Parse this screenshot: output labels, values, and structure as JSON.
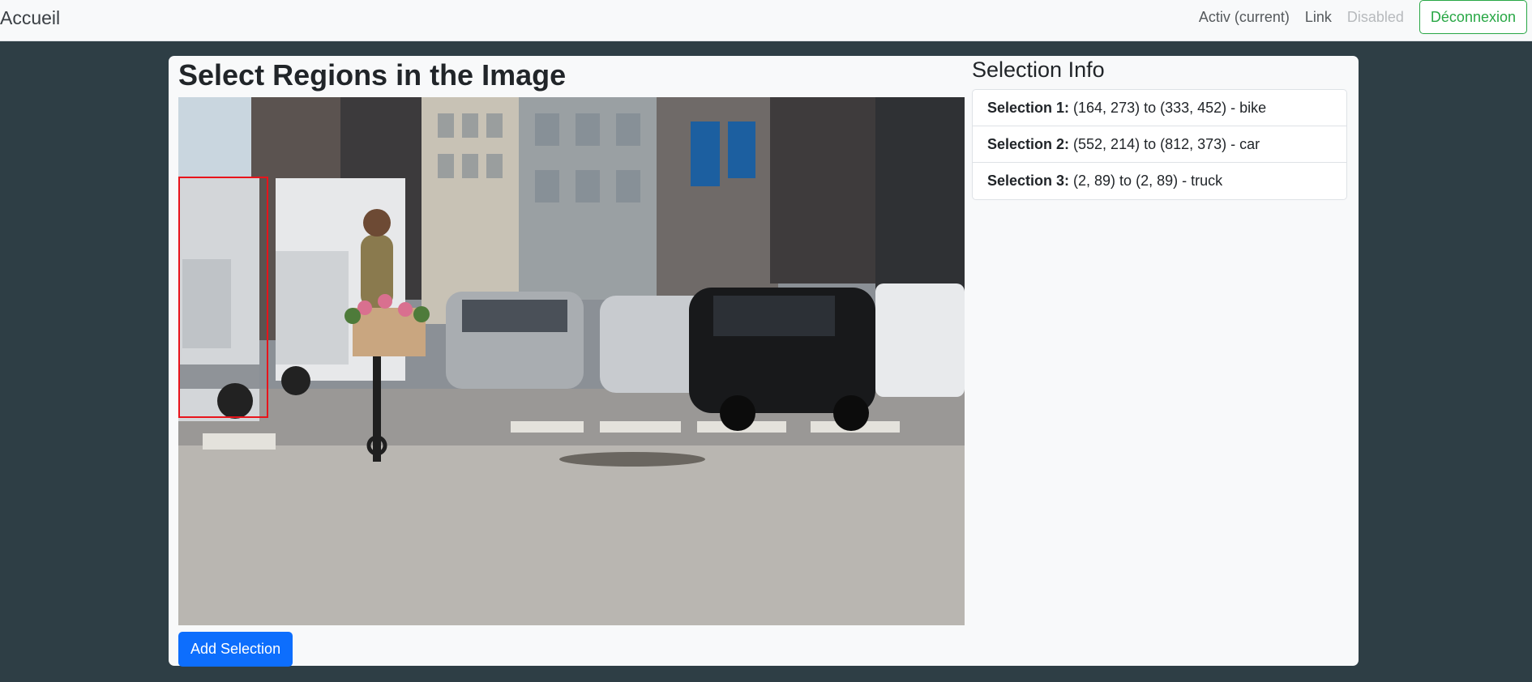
{
  "nav": {
    "brand": "Accueil",
    "links": [
      "Activ (current)",
      "Link",
      "Disabled"
    ],
    "logout_label": "Déconnexion"
  },
  "main": {
    "title": "Select Regions in the Image",
    "add_button_label": "Add Selection"
  },
  "info": {
    "title": "Selection Info",
    "items": [
      {
        "label": "Selection 1:",
        "text": " (164, 273) to (333, 452) - bike"
      },
      {
        "label": "Selection 2:",
        "text": " (552, 214) to (812, 373) - car"
      },
      {
        "label": "Selection 3:",
        "text": " (2, 89) to (2, 89) - truck"
      }
    ]
  },
  "colors": {
    "accent_blue": "#0d6efd",
    "logout_green": "#28a745",
    "selection_red": "#e8141b",
    "background": "#2e3e45"
  }
}
